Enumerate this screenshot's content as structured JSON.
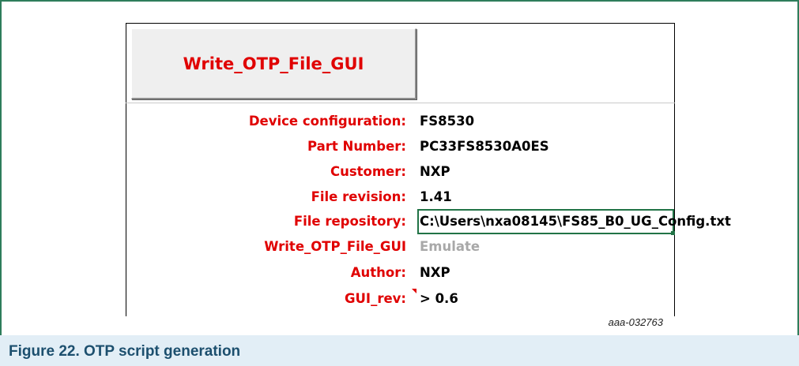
{
  "macro_button": {
    "label": "Write_OTP_File_GUI"
  },
  "rows": [
    {
      "label": "Device configuration:",
      "value": "FS8530"
    },
    {
      "label": "Part Number:",
      "value": "PC33FS8530A0ES"
    },
    {
      "label": "Customer:",
      "value": "NXP"
    },
    {
      "label": "File revision:",
      "value": "1.41"
    },
    {
      "label": "File repository:",
      "value": "C:\\Users\\nxa08145\\FS85_B0_UG_Config.txt"
    },
    {
      "label": "Write_OTP_File_GUI",
      "value": "Emulate"
    },
    {
      "label": "Author:",
      "value": "NXP"
    },
    {
      "label": "GUI_rev:",
      "value": "> 0.6"
    }
  ],
  "figure_id": "aaa-032763",
  "caption": "Figure 22.  OTP script generation",
  "colors": {
    "frame": "#2e7d5b",
    "label_red": "#e00000",
    "caption_band": "#e2eef6",
    "caption_text": "#1c4f6e",
    "selected_cell": "#217346",
    "muted_value": "#a8a8a8"
  }
}
